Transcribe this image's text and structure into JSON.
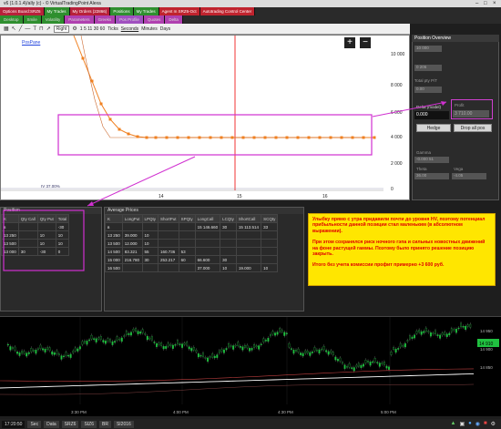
{
  "window": {
    "title": "v6 (1.0.1.4)/ally (c) - © VirtualTradingPoint Alexa"
  },
  "tabs": [
    {
      "label": "Options Board:SRZ6",
      "color": "#b8213a"
    },
    {
      "label": "My Trades",
      "color": "#2f8f2f"
    },
    {
      "label": "My Orders (22866)",
      "color": "#b8213a"
    },
    {
      "label": "Positions",
      "color": "#2f8f2f"
    },
    {
      "label": "My Trades",
      "color": "#2f8f2f"
    },
    {
      "label": "Agent m SRZ6-Oct",
      "color": "#c0232e"
    },
    {
      "label": "Autotrading Control Center",
      "color": "#c0232e"
    }
  ],
  "subtabs": [
    {
      "label": "Desktop",
      "color": "#2f8f2f"
    },
    {
      "label": "Smile",
      "color": "#2f8f2f"
    },
    {
      "label": "Volatility",
      "color": "#2f8f2f"
    },
    {
      "label": "Parameters",
      "color": "#b040b0"
    },
    {
      "label": "Greeks",
      "color": "#b040b0"
    },
    {
      "label": "Pos Profile",
      "color": "#a050c0"
    },
    {
      "label": "Quotes",
      "color": "#b040b0"
    },
    {
      "label": "Delta",
      "color": "#b040b0"
    }
  ],
  "toolbar": {
    "mode": "Right",
    "time": "1 5 11 30 60",
    "ticks_label": "Ticks",
    "seconds_label": "Seconds",
    "minutes_label": "Minutes",
    "days_label": "Days"
  },
  "payoff": {
    "label": "PosPane",
    "zoom_in": "+",
    "zoom_out": "−",
    "y_ticks": [
      "10 000",
      "8 000",
      "6 000",
      "4 000",
      "2 000",
      "0"
    ],
    "x_ticks": [
      "14",
      "15",
      "16"
    ],
    "bottom_left": "IV 37.00%"
  },
  "ppo": {
    "title": "Position Overview",
    "delta_label": "Delta (model)",
    "delta_value": "0.000",
    "profit_label": "Profit",
    "profit_value": "3 710.00",
    "hedge_btn": "Hedge",
    "drop_btn": "Drop all pos",
    "theta_label": "Theta",
    "vega_label": "Vega",
    "theta_value": "36.00",
    "vega_value": "-4.05",
    "field_a": "10 000",
    "field_b": "0 206",
    "field_c": "Total pty P/T",
    "field_d": "0.00",
    "gamma_label": "Gamma",
    "gamma_value": "-0.000 51"
  },
  "position": {
    "title": "Position",
    "headers": [
      "K",
      "Qty Call",
      "Qty Put",
      "Total"
    ],
    "rows": [
      [
        "в",
        "",
        "",
        "-30"
      ],
      [
        "13 250",
        "",
        "10",
        "10"
      ],
      [
        "13 500",
        "",
        "10",
        "10"
      ],
      [
        "13 000",
        "30",
        "-30",
        "0"
      ]
    ]
  },
  "avg": {
    "title": "Average Prices",
    "headers": [
      "K",
      "LongPut",
      "LPQty",
      "ShortPut",
      "SPQty",
      "LongCall",
      "LCQty",
      "ShortCall",
      "SCQty"
    ],
    "rows": [
      [
        "в",
        "",
        "",
        "",
        "",
        "15 146.660",
        "30",
        "15 113.514",
        "33"
      ],
      [
        "13 250",
        "39.000",
        "10",
        "",
        "",
        "",
        "",
        "",
        ""
      ],
      [
        "13 500",
        "12.000",
        "10",
        "",
        "",
        "",
        "",
        "",
        ""
      ],
      [
        "14 500",
        "83.321",
        "55",
        "160.736",
        "53",
        "",
        "",
        "",
        ""
      ],
      [
        "15 000",
        "216.780",
        "30",
        "253.217",
        "60",
        "66.600",
        "30",
        "",
        ""
      ],
      [
        "16 500",
        "",
        "",
        "",
        "",
        "37.000",
        "10",
        "19.000",
        "10"
      ]
    ]
  },
  "note": {
    "p1": "Улыбку прямо с утра придавили почти до уровня HV, поэтому потенциал прибыльности данной позиции стал маленьким (в абсолютном выражении).",
    "p2": "При этом сохранялся риск ночного гэпа и сильных новостных движений на фоне растущей гаммы. Поэтому было принято решение позицию закрыть.",
    "p3": "Итого без учета комиссии профит примерно +3 600 руб."
  },
  "pricechart": {
    "y_ticks": [
      "14 950",
      "14 900",
      "14 850"
    ],
    "x_ticks": [
      "3:30 PM",
      "4:00 PM",
      "4:30 PM",
      "5:00 PM"
    ],
    "last_price": "14 910"
  },
  "status": {
    "time": "17:20:50",
    "items": [
      "Sec",
      "Data",
      "SRZ6",
      "SIZ6",
      "BR",
      "SI2016"
    ]
  }
}
